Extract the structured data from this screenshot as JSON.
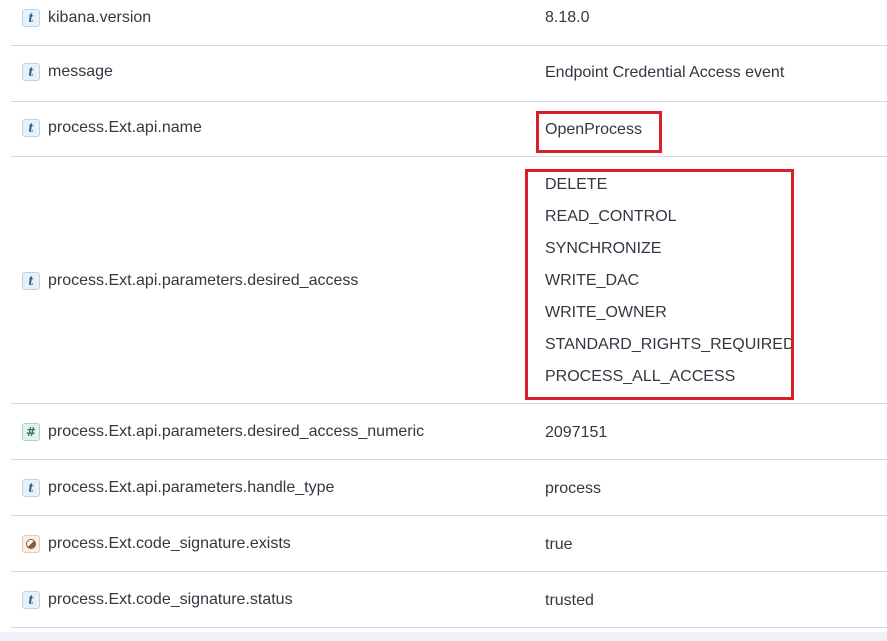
{
  "rows": [
    {
      "field": "kibana.version",
      "type": "string",
      "value": "8.18.0"
    },
    {
      "field": "message",
      "type": "string",
      "value": "Endpoint Credential Access event"
    },
    {
      "field": "process.Ext.api.name",
      "type": "string",
      "value": "OpenProcess"
    },
    {
      "field": "process.Ext.api.parameters.desired_access",
      "type": "string",
      "values": [
        "DELETE",
        "READ_CONTROL",
        "SYNCHRONIZE",
        "WRITE_DAC",
        "WRITE_OWNER",
        "STANDARD_RIGHTS_REQUIRED",
        "PROCESS_ALL_ACCESS"
      ]
    },
    {
      "field": "process.Ext.api.parameters.desired_access_numeric",
      "type": "number",
      "value": "2097151"
    },
    {
      "field": "process.Ext.api.parameters.handle_type",
      "type": "string",
      "value": "process"
    },
    {
      "field": "process.Ext.code_signature.exists",
      "type": "boolean",
      "value": "true"
    },
    {
      "field": "process.Ext.code_signature.status",
      "type": "string",
      "value": "trusted"
    }
  ],
  "icons": {
    "string": {
      "glyph": "t",
      "name": "string-type-icon"
    },
    "number": {
      "glyph": "#",
      "name": "number-type-icon"
    },
    "boolean": {
      "glyph": "",
      "name": "boolean-type-icon"
    }
  },
  "highlight_color": "#d9202a"
}
